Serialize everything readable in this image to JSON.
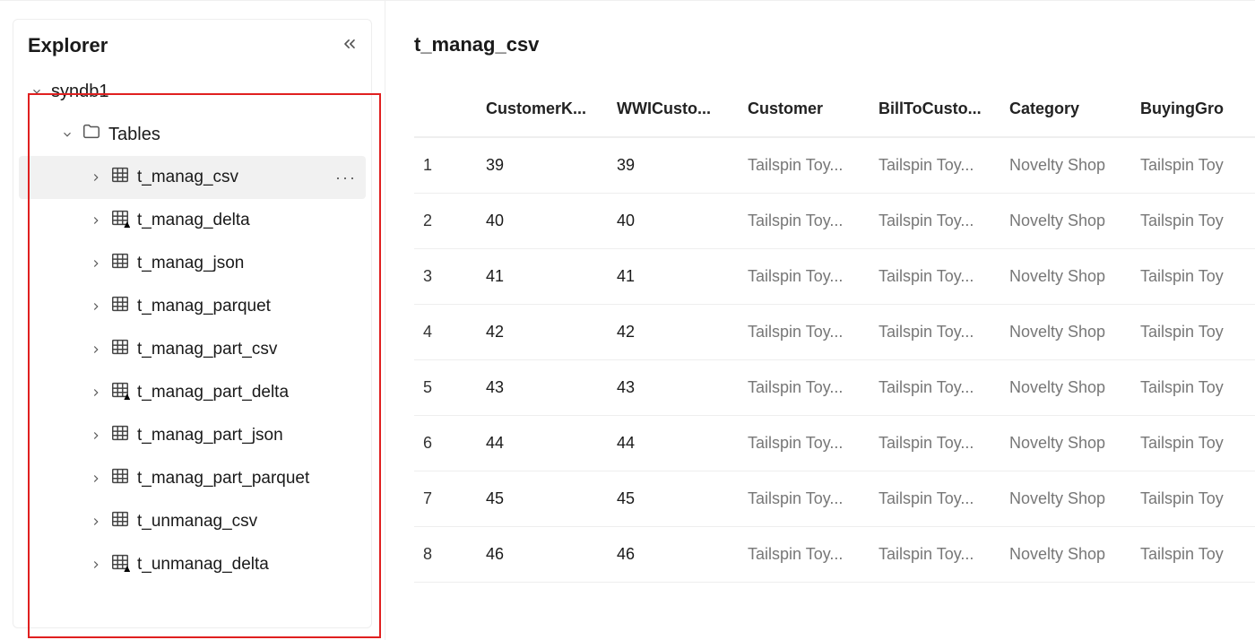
{
  "sidebar": {
    "title": "Explorer",
    "database": "syndb1",
    "tables_label": "Tables",
    "selected_table": "t_manag_csv",
    "tables": [
      {
        "name": "t_manag_csv",
        "icon": "table",
        "selected": true
      },
      {
        "name": "t_manag_delta",
        "icon": "delta",
        "selected": false
      },
      {
        "name": "t_manag_json",
        "icon": "table",
        "selected": false
      },
      {
        "name": "t_manag_parquet",
        "icon": "table",
        "selected": false
      },
      {
        "name": "t_manag_part_csv",
        "icon": "table",
        "selected": false
      },
      {
        "name": "t_manag_part_delta",
        "icon": "delta",
        "selected": false
      },
      {
        "name": "t_manag_part_json",
        "icon": "table",
        "selected": false
      },
      {
        "name": "t_manag_part_parquet",
        "icon": "table",
        "selected": false
      },
      {
        "name": "t_unmanag_csv",
        "icon": "table",
        "selected": false
      },
      {
        "name": "t_unmanag_delta",
        "icon": "delta",
        "selected": false
      }
    ]
  },
  "main": {
    "title": "t_manag_csv",
    "columns": [
      "CustomerK...",
      "WWICusto...",
      "Customer",
      "BillToCusto...",
      "Category",
      "BuyingGro"
    ],
    "rows": [
      {
        "n": "1",
        "cells": [
          "39",
          "39",
          "Tailspin Toy...",
          "Tailspin Toy...",
          "Novelty Shop",
          "Tailspin Toy"
        ]
      },
      {
        "n": "2",
        "cells": [
          "40",
          "40",
          "Tailspin Toy...",
          "Tailspin Toy...",
          "Novelty Shop",
          "Tailspin Toy"
        ]
      },
      {
        "n": "3",
        "cells": [
          "41",
          "41",
          "Tailspin Toy...",
          "Tailspin Toy...",
          "Novelty Shop",
          "Tailspin Toy"
        ]
      },
      {
        "n": "4",
        "cells": [
          "42",
          "42",
          "Tailspin Toy...",
          "Tailspin Toy...",
          "Novelty Shop",
          "Tailspin Toy"
        ]
      },
      {
        "n": "5",
        "cells": [
          "43",
          "43",
          "Tailspin Toy...",
          "Tailspin Toy...",
          "Novelty Shop",
          "Tailspin Toy"
        ]
      },
      {
        "n": "6",
        "cells": [
          "44",
          "44",
          "Tailspin Toy...",
          "Tailspin Toy...",
          "Novelty Shop",
          "Tailspin Toy"
        ]
      },
      {
        "n": "7",
        "cells": [
          "45",
          "45",
          "Tailspin Toy...",
          "Tailspin Toy...",
          "Novelty Shop",
          "Tailspin Toy"
        ]
      },
      {
        "n": "8",
        "cells": [
          "46",
          "46",
          "Tailspin Toy...",
          "Tailspin Toy...",
          "Novelty Shop",
          "Tailspin Toy"
        ]
      }
    ]
  }
}
